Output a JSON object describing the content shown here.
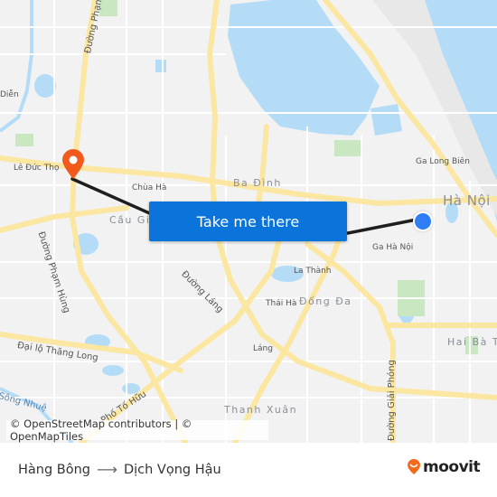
{
  "map": {
    "action_button": "Take me there",
    "attribution": "© OpenStreetMap contributors | © OpenMapTiles",
    "labels": {
      "districts": [
        "Ba Đình",
        "Đống Đa",
        "Cầu Giấy",
        "Thanh Xuân",
        "Hai Bà Trưng"
      ],
      "city": "Hà Nội",
      "places": [
        "Lê Đức Thọ",
        "Chùa Hà",
        "Ga Long Biên",
        "Ga Hà Nội",
        "La Thành",
        "Thái Hà",
        "Láng",
        "Diễn"
      ],
      "roads": [
        "Đường Phạm Hùng",
        "Đường Láng",
        "Đại lộ Thăng Long",
        "Phố Tố Hữu",
        "Đường Giải Phóng",
        "Đường Phạm Văn Đồng",
        "Sông Nhuệ",
        "Đường",
        "Đường",
        "Đườ"
      ]
    },
    "origin_marker": "orange-pin",
    "destination_marker": "blue-dot"
  },
  "footer": {
    "origin": "Hàng Bông",
    "arrow": "⟶",
    "destination": "Dịch Vọng Hậu",
    "brand": "moovit"
  },
  "colors": {
    "button": "#0a74da",
    "origin_pin": "#f25a1d",
    "destination_dot": "#2e7df5",
    "route_line": "#1e1e1e",
    "water": "#b5dcf7",
    "road_major": "#fbe7a1",
    "park": "#c9e8c1"
  }
}
